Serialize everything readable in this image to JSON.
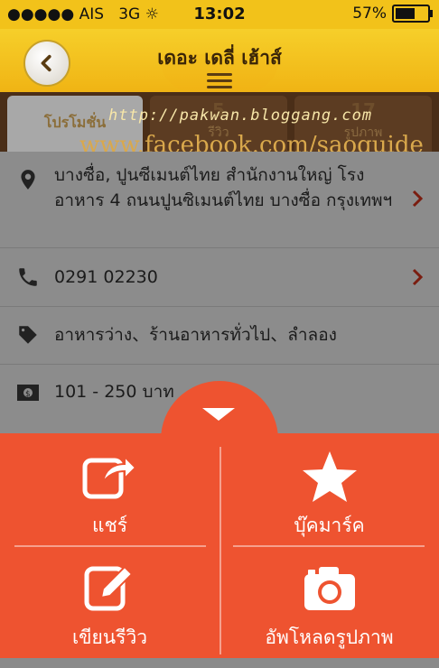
{
  "status": {
    "carrier": "●●●●● AIS",
    "network": "3G",
    "time": "13:02",
    "battery": "57%",
    "battery_level": 0.57
  },
  "nav": {
    "title": "เดอะ เดลี่ เฮ้าส์"
  },
  "tabs": [
    {
      "label": "โปรโมชั่น",
      "count": ""
    },
    {
      "label": "รีวิว",
      "count": "5"
    },
    {
      "label": "รูปภาพ",
      "count": "17"
    }
  ],
  "watermarks": {
    "blog": "http://pakwan.bloggang.com",
    "facebook": "www.facebook.com/saoguide"
  },
  "info": {
    "address": "บางซื่อ, ปูนซีเมนต์ไทย สำนักงานใหญ่ โรงอาหาร 4 ถนนปูนซิเมนต์ไทย บางซื่อ กรุงเทพฯ",
    "phone": "0291 02230",
    "categories": "อาหารว่าง、ร้านอาหารทั่วไป、ลำลอง",
    "price": "101 - 250 บาท"
  },
  "actions": {
    "share": "แชร์",
    "bookmark": "บุ๊คมาร์ค",
    "review": "เขียนรีวิว",
    "upload": "อัพโหลดรูปภาพ"
  },
  "colors": {
    "accent": "#ee5330",
    "header": "#f2c21a",
    "tabs": "#4a2e18"
  }
}
